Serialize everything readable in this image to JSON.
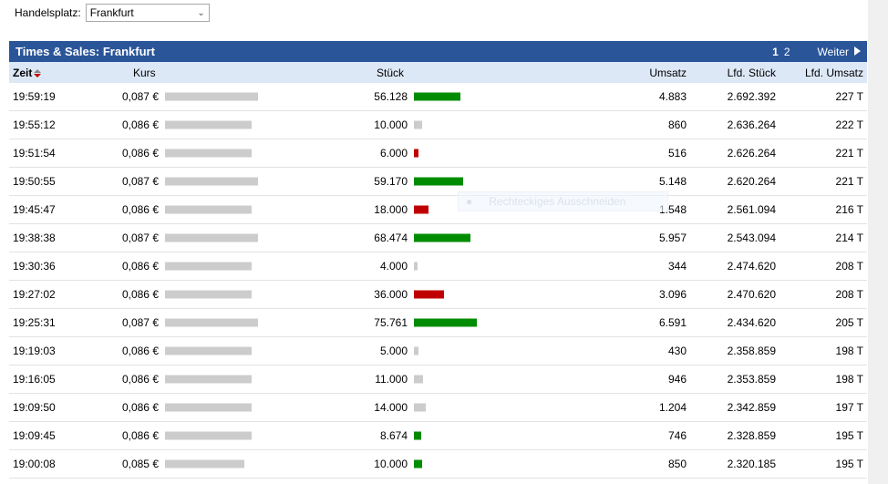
{
  "handelsplatz": {
    "label": "Handelsplatz:",
    "value": "Frankfurt"
  },
  "panel": {
    "title": "Times & Sales: Frankfurt",
    "pages": [
      "1",
      "2"
    ],
    "next": "Weiter"
  },
  "columns": {
    "zeit": "Zeit",
    "kurs": "Kurs",
    "stueck": "Stück",
    "umsatz": "Umsatz",
    "lfd_stueck": "Lfd. Stück",
    "lfd_umsatz": "Lfd. Umsatz"
  },
  "colors": {
    "up": "#008c00",
    "down": "#c00000",
    "neutral": "#cccccc",
    "header": "#2a5599"
  },
  "overlay": "Rechteckiges Ausschneiden",
  "rows": [
    {
      "zeit": "19:59:19",
      "kurs": "0,087 €",
      "kurs_value": 0.087,
      "stueck": "56.128",
      "stueck_value": 56128,
      "dir": "up",
      "umsatz": "4.883",
      "lfd_stueck": "2.692.392",
      "lfd_umsatz": "227 T"
    },
    {
      "zeit": "19:55:12",
      "kurs": "0,086 €",
      "kurs_value": 0.086,
      "stueck": "10.000",
      "stueck_value": 10000,
      "dir": "neutral",
      "umsatz": "860",
      "lfd_stueck": "2.636.264",
      "lfd_umsatz": "222 T"
    },
    {
      "zeit": "19:51:54",
      "kurs": "0,086 €",
      "kurs_value": 0.086,
      "stueck": "6.000",
      "stueck_value": 6000,
      "dir": "down",
      "umsatz": "516",
      "lfd_stueck": "2.626.264",
      "lfd_umsatz": "221 T"
    },
    {
      "zeit": "19:50:55",
      "kurs": "0,087 €",
      "kurs_value": 0.087,
      "stueck": "59.170",
      "stueck_value": 59170,
      "dir": "up",
      "umsatz": "5.148",
      "lfd_stueck": "2.620.264",
      "lfd_umsatz": "221 T"
    },
    {
      "zeit": "19:45:47",
      "kurs": "0,086 €",
      "kurs_value": 0.086,
      "stueck": "18.000",
      "stueck_value": 18000,
      "dir": "down",
      "umsatz": "1.548",
      "lfd_stueck": "2.561.094",
      "lfd_umsatz": "216 T"
    },
    {
      "zeit": "19:38:38",
      "kurs": "0,087 €",
      "kurs_value": 0.087,
      "stueck": "68.474",
      "stueck_value": 68474,
      "dir": "up",
      "umsatz": "5.957",
      "lfd_stueck": "2.543.094",
      "lfd_umsatz": "214 T"
    },
    {
      "zeit": "19:30:36",
      "kurs": "0,086 €",
      "kurs_value": 0.086,
      "stueck": "4.000",
      "stueck_value": 4000,
      "dir": "neutral",
      "umsatz": "344",
      "lfd_stueck": "2.474.620",
      "lfd_umsatz": "208 T"
    },
    {
      "zeit": "19:27:02",
      "kurs": "0,086 €",
      "kurs_value": 0.086,
      "stueck": "36.000",
      "stueck_value": 36000,
      "dir": "down",
      "umsatz": "3.096",
      "lfd_stueck": "2.470.620",
      "lfd_umsatz": "208 T"
    },
    {
      "zeit": "19:25:31",
      "kurs": "0,087 €",
      "kurs_value": 0.087,
      "stueck": "75.761",
      "stueck_value": 75761,
      "dir": "up",
      "umsatz": "6.591",
      "lfd_stueck": "2.434.620",
      "lfd_umsatz": "205 T"
    },
    {
      "zeit": "19:19:03",
      "kurs": "0,086 €",
      "kurs_value": 0.086,
      "stueck": "5.000",
      "stueck_value": 5000,
      "dir": "neutral",
      "umsatz": "430",
      "lfd_stueck": "2.358.859",
      "lfd_umsatz": "198 T"
    },
    {
      "zeit": "19:16:05",
      "kurs": "0,086 €",
      "kurs_value": 0.086,
      "stueck": "11.000",
      "stueck_value": 11000,
      "dir": "neutral",
      "umsatz": "946",
      "lfd_stueck": "2.353.859",
      "lfd_umsatz": "198 T"
    },
    {
      "zeit": "19:09:50",
      "kurs": "0,086 €",
      "kurs_value": 0.086,
      "stueck": "14.000",
      "stueck_value": 14000,
      "dir": "neutral",
      "umsatz": "1.204",
      "lfd_stueck": "2.342.859",
      "lfd_umsatz": "197 T"
    },
    {
      "zeit": "19:09:45",
      "kurs": "0,086 €",
      "kurs_value": 0.086,
      "stueck": "8.674",
      "stueck_value": 8674,
      "dir": "up",
      "umsatz": "746",
      "lfd_stueck": "2.328.859",
      "lfd_umsatz": "195 T"
    },
    {
      "zeit": "19:00:08",
      "kurs": "0,085 €",
      "kurs_value": 0.085,
      "stueck": "10.000",
      "stueck_value": 10000,
      "dir": "up",
      "umsatz": "850",
      "lfd_stueck": "2.320.185",
      "lfd_umsatz": "195 T"
    }
  ]
}
